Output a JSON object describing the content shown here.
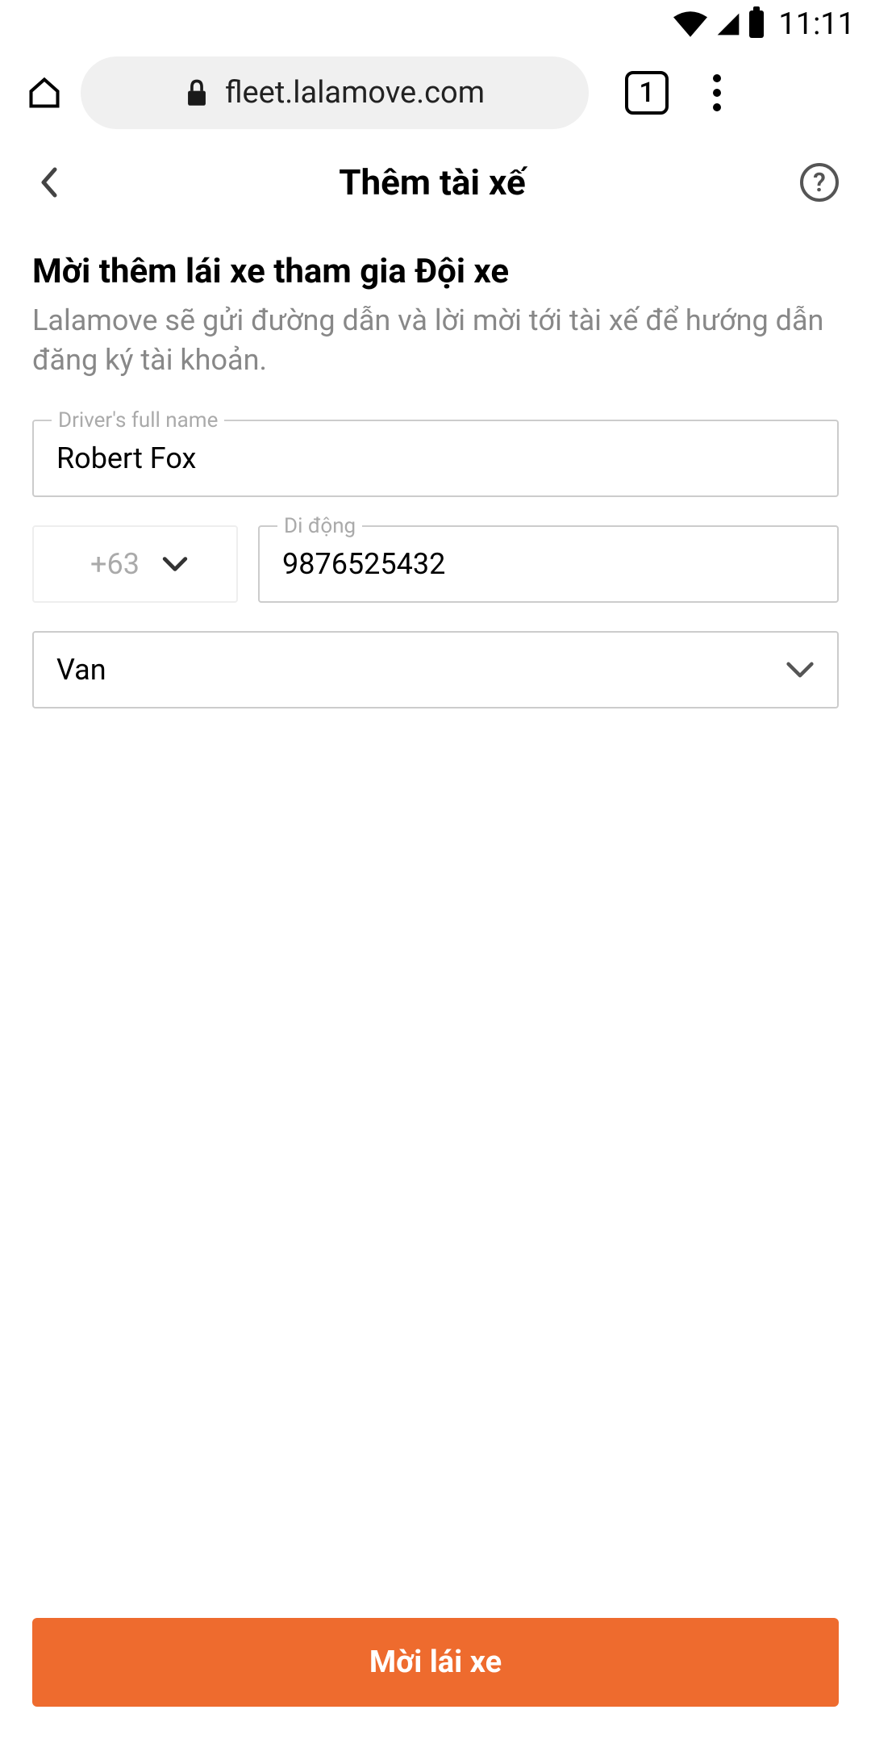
{
  "status_bar": {
    "time": "11:11"
  },
  "browser": {
    "url": "fleet.lalamove.com",
    "tab_count": "1"
  },
  "header": {
    "title": "Thêm tài xế",
    "help_label": "?"
  },
  "main": {
    "heading": "Mời thêm lái xe tham gia Đội xe",
    "description": "Lalamove sẽ gửi đường dẫn và lời mời tới tài xế để hướng dẫn đăng ký tài khoản."
  },
  "form": {
    "name_label": "Driver's full name",
    "name_value": "Robert Fox",
    "phone_label": "Di động",
    "country_code": "+63",
    "phone_value": "9876525432",
    "vehicle_value": "Van"
  },
  "footer": {
    "submit_label": "Mời lái xe"
  },
  "colors": {
    "accent": "#ee6b2e",
    "border": "#ccc",
    "muted_text": "#888"
  }
}
